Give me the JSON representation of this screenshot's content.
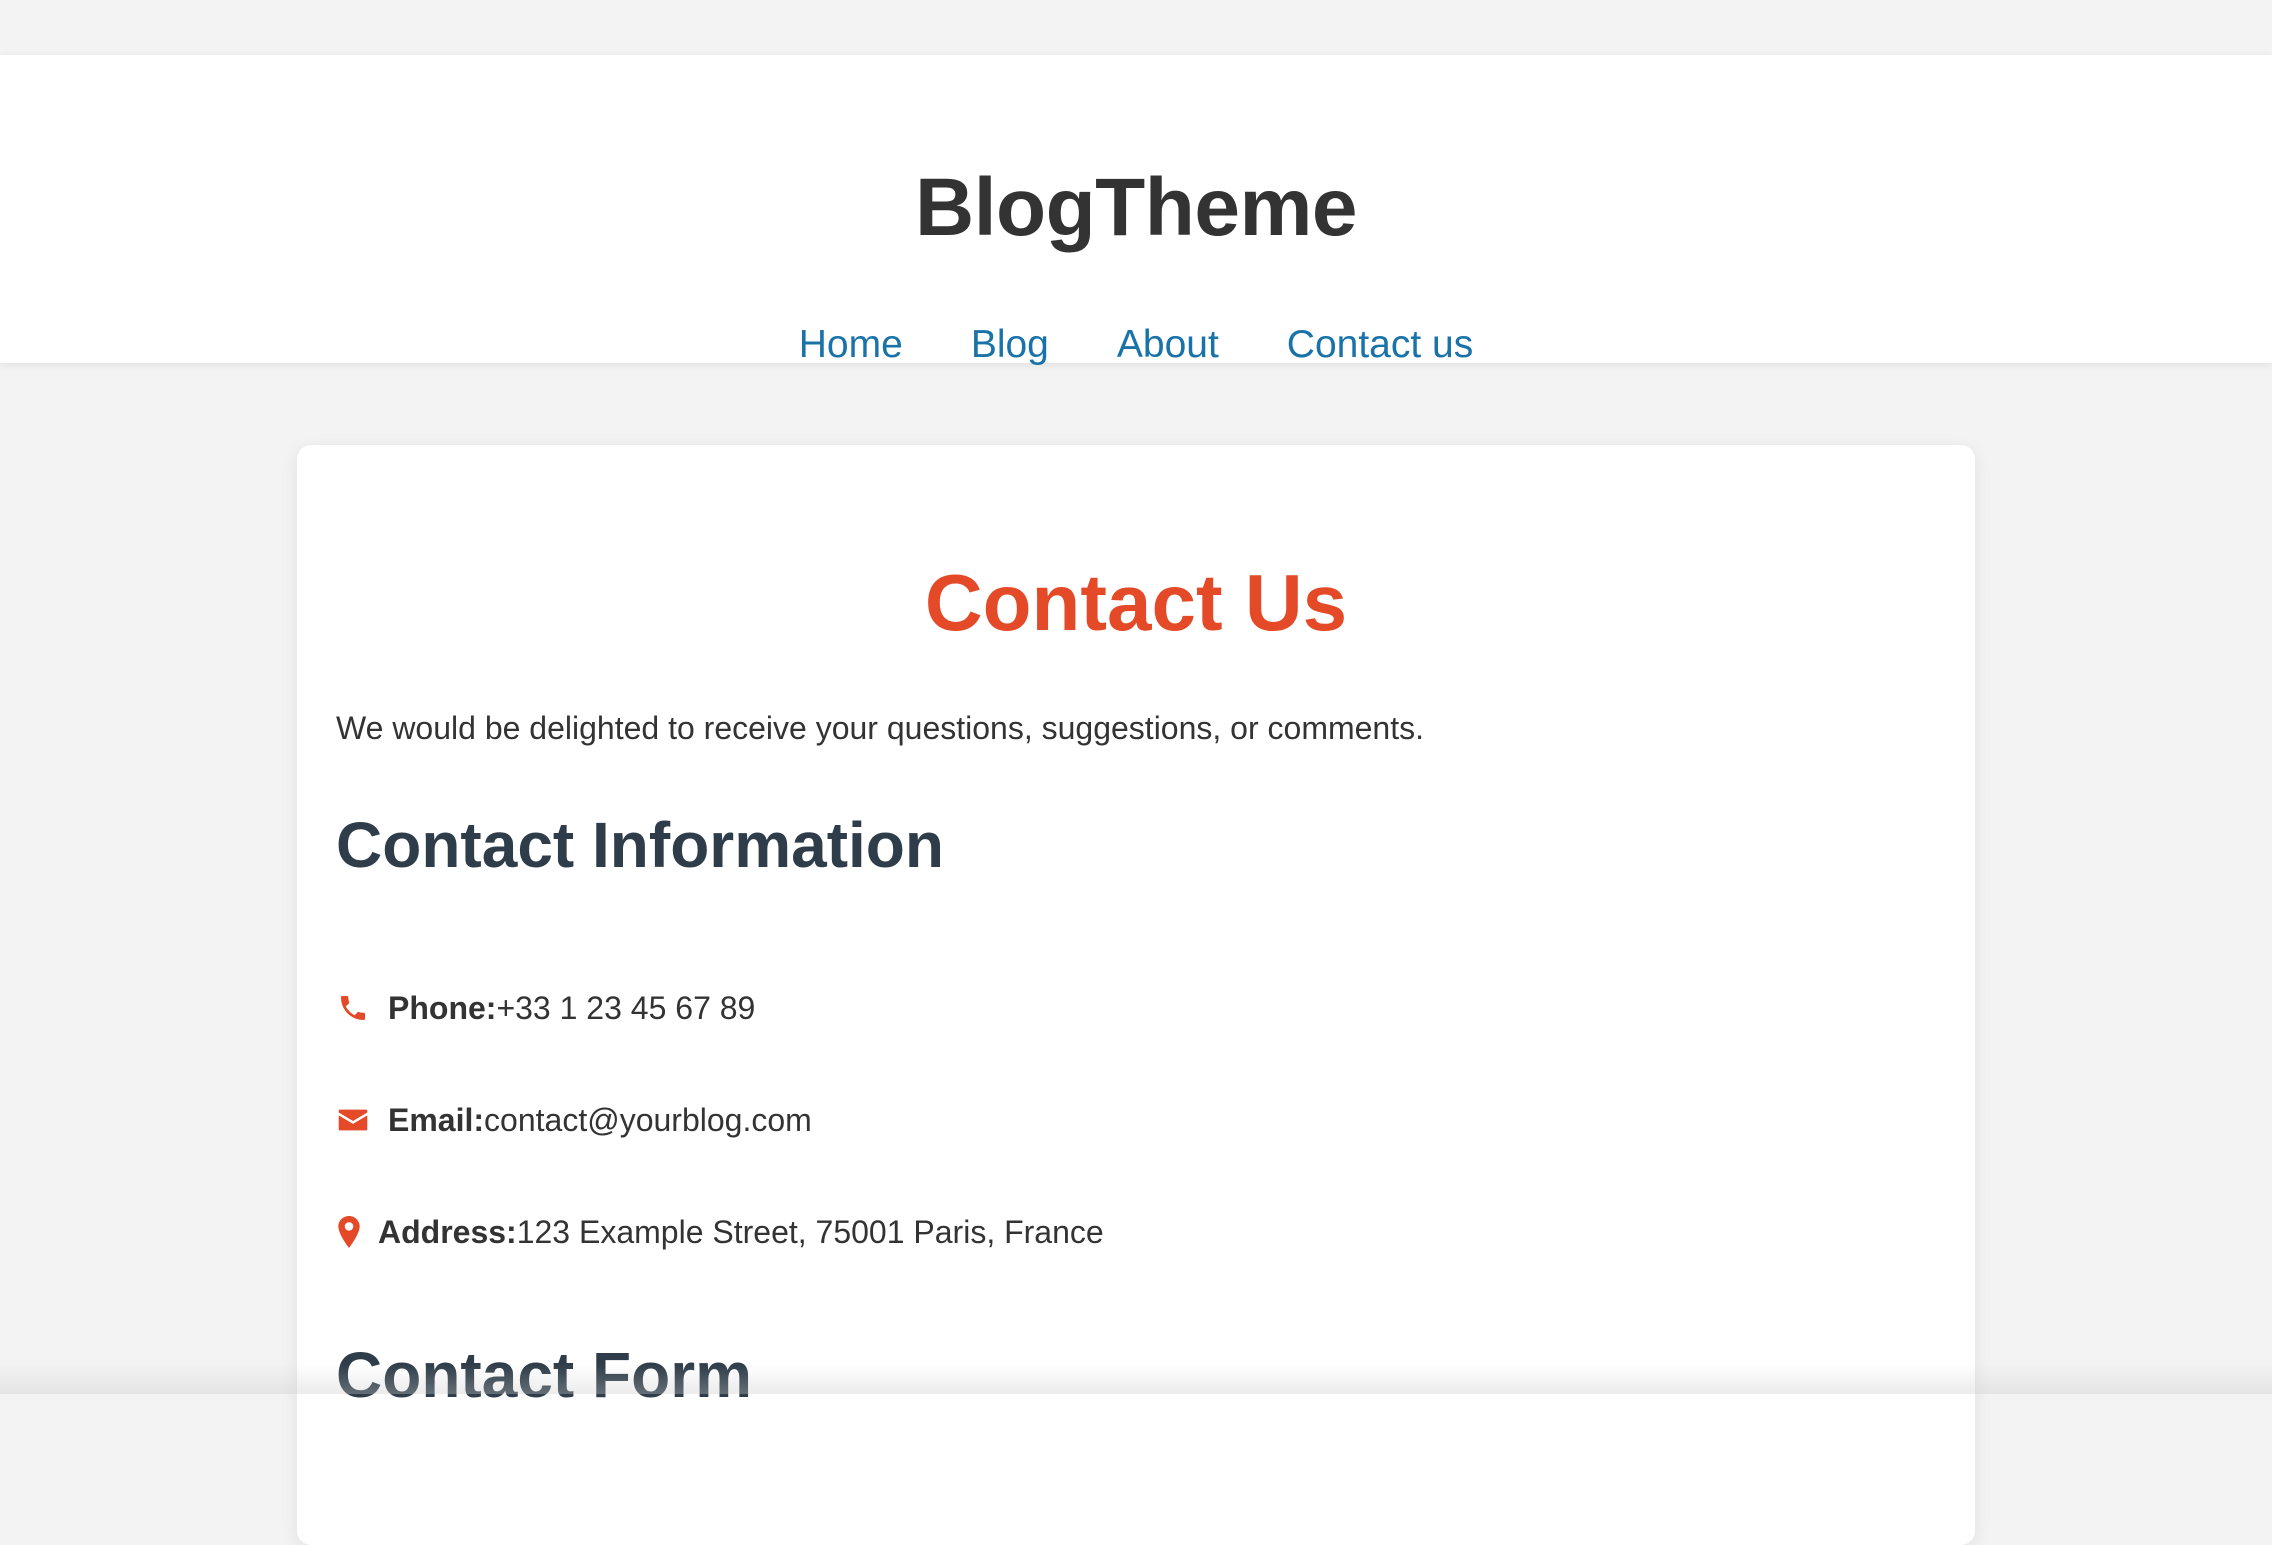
{
  "header": {
    "site_title": "BlogTheme",
    "nav": [
      {
        "label": "Home"
      },
      {
        "label": "Blog"
      },
      {
        "label": "About"
      },
      {
        "label": "Contact us"
      }
    ]
  },
  "main": {
    "title": "Contact Us",
    "intro": "We would be delighted to receive your questions, suggestions, or comments.",
    "contact_info": {
      "heading": "Contact Information",
      "items": [
        {
          "icon": "phone-icon",
          "label": "Phone:",
          "value": "+33 1 23 45 67 89"
        },
        {
          "icon": "email-icon",
          "label": "Email:",
          "value": "contact@yourblog.com"
        },
        {
          "icon": "location-pin-icon",
          "label": "Address:",
          "value": "123 Example Street, 75001 Paris, France"
        }
      ]
    },
    "contact_form": {
      "heading": "Contact Form"
    }
  },
  "colors": {
    "accent": "#e44a28",
    "link": "#1a73a8",
    "heading": "#2e3d49",
    "text": "#333333",
    "page_bg": "#f3f3f3"
  }
}
